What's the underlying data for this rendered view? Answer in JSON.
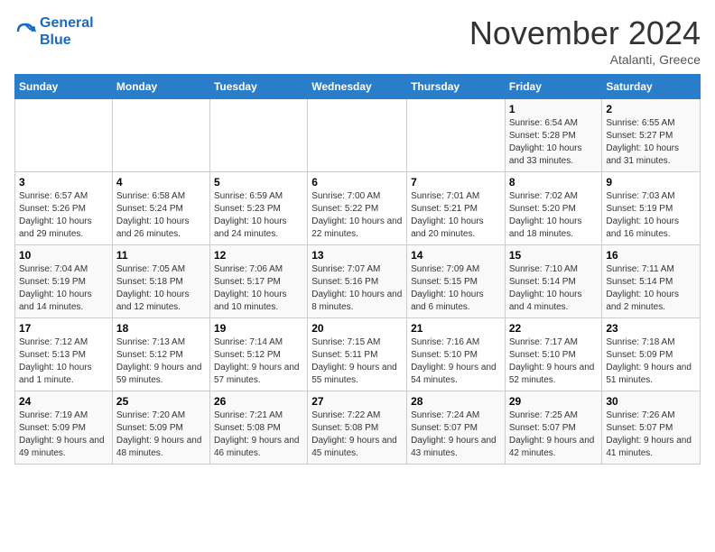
{
  "header": {
    "logo_line1": "General",
    "logo_line2": "Blue",
    "month": "November 2024",
    "location": "Atalanti, Greece"
  },
  "weekdays": [
    "Sunday",
    "Monday",
    "Tuesday",
    "Wednesday",
    "Thursday",
    "Friday",
    "Saturday"
  ],
  "weeks": [
    [
      {
        "day": "",
        "info": ""
      },
      {
        "day": "",
        "info": ""
      },
      {
        "day": "",
        "info": ""
      },
      {
        "day": "",
        "info": ""
      },
      {
        "day": "",
        "info": ""
      },
      {
        "day": "1",
        "info": "Sunrise: 6:54 AM\nSunset: 5:28 PM\nDaylight: 10 hours and 33 minutes."
      },
      {
        "day": "2",
        "info": "Sunrise: 6:55 AM\nSunset: 5:27 PM\nDaylight: 10 hours and 31 minutes."
      }
    ],
    [
      {
        "day": "3",
        "info": "Sunrise: 6:57 AM\nSunset: 5:26 PM\nDaylight: 10 hours and 29 minutes."
      },
      {
        "day": "4",
        "info": "Sunrise: 6:58 AM\nSunset: 5:24 PM\nDaylight: 10 hours and 26 minutes."
      },
      {
        "day": "5",
        "info": "Sunrise: 6:59 AM\nSunset: 5:23 PM\nDaylight: 10 hours and 24 minutes."
      },
      {
        "day": "6",
        "info": "Sunrise: 7:00 AM\nSunset: 5:22 PM\nDaylight: 10 hours and 22 minutes."
      },
      {
        "day": "7",
        "info": "Sunrise: 7:01 AM\nSunset: 5:21 PM\nDaylight: 10 hours and 20 minutes."
      },
      {
        "day": "8",
        "info": "Sunrise: 7:02 AM\nSunset: 5:20 PM\nDaylight: 10 hours and 18 minutes."
      },
      {
        "day": "9",
        "info": "Sunrise: 7:03 AM\nSunset: 5:19 PM\nDaylight: 10 hours and 16 minutes."
      }
    ],
    [
      {
        "day": "10",
        "info": "Sunrise: 7:04 AM\nSunset: 5:19 PM\nDaylight: 10 hours and 14 minutes."
      },
      {
        "day": "11",
        "info": "Sunrise: 7:05 AM\nSunset: 5:18 PM\nDaylight: 10 hours and 12 minutes."
      },
      {
        "day": "12",
        "info": "Sunrise: 7:06 AM\nSunset: 5:17 PM\nDaylight: 10 hours and 10 minutes."
      },
      {
        "day": "13",
        "info": "Sunrise: 7:07 AM\nSunset: 5:16 PM\nDaylight: 10 hours and 8 minutes."
      },
      {
        "day": "14",
        "info": "Sunrise: 7:09 AM\nSunset: 5:15 PM\nDaylight: 10 hours and 6 minutes."
      },
      {
        "day": "15",
        "info": "Sunrise: 7:10 AM\nSunset: 5:14 PM\nDaylight: 10 hours and 4 minutes."
      },
      {
        "day": "16",
        "info": "Sunrise: 7:11 AM\nSunset: 5:14 PM\nDaylight: 10 hours and 2 minutes."
      }
    ],
    [
      {
        "day": "17",
        "info": "Sunrise: 7:12 AM\nSunset: 5:13 PM\nDaylight: 10 hours and 1 minute."
      },
      {
        "day": "18",
        "info": "Sunrise: 7:13 AM\nSunset: 5:12 PM\nDaylight: 9 hours and 59 minutes."
      },
      {
        "day": "19",
        "info": "Sunrise: 7:14 AM\nSunset: 5:12 PM\nDaylight: 9 hours and 57 minutes."
      },
      {
        "day": "20",
        "info": "Sunrise: 7:15 AM\nSunset: 5:11 PM\nDaylight: 9 hours and 55 minutes."
      },
      {
        "day": "21",
        "info": "Sunrise: 7:16 AM\nSunset: 5:10 PM\nDaylight: 9 hours and 54 minutes."
      },
      {
        "day": "22",
        "info": "Sunrise: 7:17 AM\nSunset: 5:10 PM\nDaylight: 9 hours and 52 minutes."
      },
      {
        "day": "23",
        "info": "Sunrise: 7:18 AM\nSunset: 5:09 PM\nDaylight: 9 hours and 51 minutes."
      }
    ],
    [
      {
        "day": "24",
        "info": "Sunrise: 7:19 AM\nSunset: 5:09 PM\nDaylight: 9 hours and 49 minutes."
      },
      {
        "day": "25",
        "info": "Sunrise: 7:20 AM\nSunset: 5:09 PM\nDaylight: 9 hours and 48 minutes."
      },
      {
        "day": "26",
        "info": "Sunrise: 7:21 AM\nSunset: 5:08 PM\nDaylight: 9 hours and 46 minutes."
      },
      {
        "day": "27",
        "info": "Sunrise: 7:22 AM\nSunset: 5:08 PM\nDaylight: 9 hours and 45 minutes."
      },
      {
        "day": "28",
        "info": "Sunrise: 7:24 AM\nSunset: 5:07 PM\nDaylight: 9 hours and 43 minutes."
      },
      {
        "day": "29",
        "info": "Sunrise: 7:25 AM\nSunset: 5:07 PM\nDaylight: 9 hours and 42 minutes."
      },
      {
        "day": "30",
        "info": "Sunrise: 7:26 AM\nSunset: 5:07 PM\nDaylight: 9 hours and 41 minutes."
      }
    ]
  ]
}
